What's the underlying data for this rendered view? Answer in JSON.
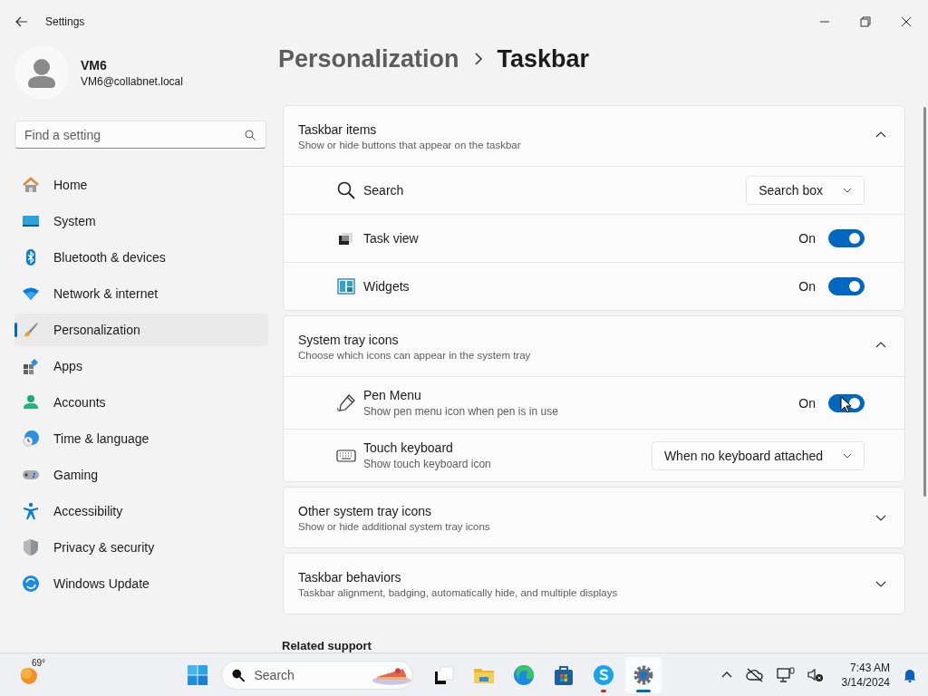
{
  "window": {
    "title": "Settings"
  },
  "user": {
    "name": "VM6",
    "email": "VM6@collabnet.local"
  },
  "search": {
    "placeholder": "Find a setting"
  },
  "nav": [
    {
      "label": "Home",
      "selected": false
    },
    {
      "label": "System",
      "selected": false
    },
    {
      "label": "Bluetooth & devices",
      "selected": false
    },
    {
      "label": "Network & internet",
      "selected": false
    },
    {
      "label": "Personalization",
      "selected": true
    },
    {
      "label": "Apps",
      "selected": false
    },
    {
      "label": "Accounts",
      "selected": false
    },
    {
      "label": "Time & language",
      "selected": false
    },
    {
      "label": "Gaming",
      "selected": false
    },
    {
      "label": "Accessibility",
      "selected": false
    },
    {
      "label": "Privacy & security",
      "selected": false
    },
    {
      "label": "Windows Update",
      "selected": false
    }
  ],
  "breadcrumb": {
    "parent": "Personalization",
    "current": "Taskbar"
  },
  "sections": [
    {
      "title": "Taskbar items",
      "subtitle": "Show or hide buttons that appear on the taskbar",
      "expanded": true,
      "items": [
        {
          "kind": "dropdown",
          "label": "Search",
          "value": "Search box"
        },
        {
          "kind": "toggle",
          "label": "Task view",
          "state": "On",
          "on": true
        },
        {
          "kind": "toggle",
          "label": "Widgets",
          "state": "On",
          "on": true
        }
      ]
    },
    {
      "title": "System tray icons",
      "subtitle": "Choose which icons can appear in the system tray",
      "expanded": true,
      "items": [
        {
          "kind": "toggle",
          "label": "Pen Menu",
          "description": "Show pen menu icon when pen is in use",
          "state": "On",
          "on": true
        },
        {
          "kind": "dropdown",
          "label": "Touch keyboard",
          "description": "Show touch keyboard icon",
          "value": "When no keyboard attached"
        }
      ]
    },
    {
      "title": "Other system tray icons",
      "subtitle": "Show or hide additional system tray icons",
      "expanded": false
    },
    {
      "title": "Taskbar behaviors",
      "subtitle": "Taskbar alignment, badging, automatically hide, and multiple displays",
      "expanded": false
    }
  ],
  "related": {
    "title": "Related support"
  },
  "taskbar": {
    "weather": "69°",
    "search_placeholder": "Search",
    "apps": [
      {
        "selected": false,
        "attention": false
      },
      {
        "selected": false,
        "attention": false
      },
      {
        "selected": false,
        "attention": false
      },
      {
        "selected": false,
        "attention": false
      },
      {
        "selected": false,
        "attention": true
      },
      {
        "selected": true,
        "attention": false
      }
    ],
    "time": "7:43 AM",
    "date": "3/14/2024"
  }
}
